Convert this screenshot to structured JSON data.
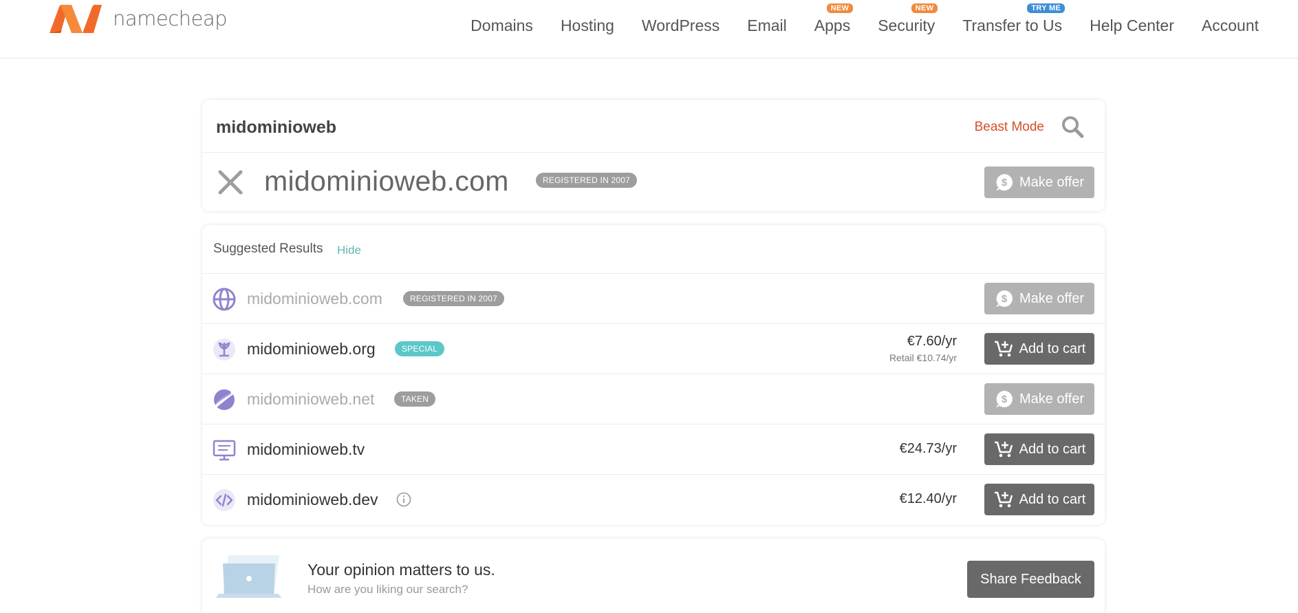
{
  "header": {
    "logo_text": "namecheap",
    "nav": [
      {
        "label": "Domains",
        "badge": ""
      },
      {
        "label": "Hosting",
        "badge": ""
      },
      {
        "label": "WordPress",
        "badge": ""
      },
      {
        "label": "Email",
        "badge": ""
      },
      {
        "label": "Apps",
        "badge": "NEW"
      },
      {
        "label": "Security",
        "badge": "NEW"
      },
      {
        "label": "Transfer to Us",
        "badge": "TRY ME"
      },
      {
        "label": "Help Center",
        "badge": ""
      },
      {
        "label": "Account",
        "badge": ""
      }
    ]
  },
  "search": {
    "query": "midominioweb",
    "beast_mode_label": "Beast Mode"
  },
  "main_result": {
    "domain": "midominioweb.com",
    "badge": "REGISTERED IN 2007",
    "button_label": "Make offer"
  },
  "suggested": {
    "title": "Suggested Results",
    "hide_label": "Hide",
    "rows": [
      {
        "domain": "midominioweb.com",
        "badge": "REGISTERED IN 2007",
        "price": "",
        "retail": "",
        "button_label": "Make offer"
      },
      {
        "domain": "midominioweb.org",
        "badge": "SPECIAL",
        "price": "€7.60/yr",
        "retail": "Retail €10.74/yr",
        "button_label": "Add to cart"
      },
      {
        "domain": "midominioweb.net",
        "badge": "TAKEN",
        "price": "",
        "retail": "",
        "button_label": "Make offer"
      },
      {
        "domain": "midominioweb.tv",
        "badge": "",
        "price": "€24.73/yr",
        "retail": "",
        "button_label": "Add to cart"
      },
      {
        "domain": "midominioweb.dev",
        "badge": "",
        "price": "€12.40/yr",
        "retail": "",
        "button_label": "Add to cart"
      }
    ]
  },
  "feedback": {
    "title": "Your opinion matters to us.",
    "subtitle": "How are you liking our search?",
    "button_label": "Share Feedback"
  },
  "colors": {
    "brand_orange": "#f26a2a",
    "beast_mode": "#d4502a",
    "hide_link": "#5fb8b0",
    "special_pill": "#5cc7c9",
    "icon_purple": "#8e83cf"
  }
}
